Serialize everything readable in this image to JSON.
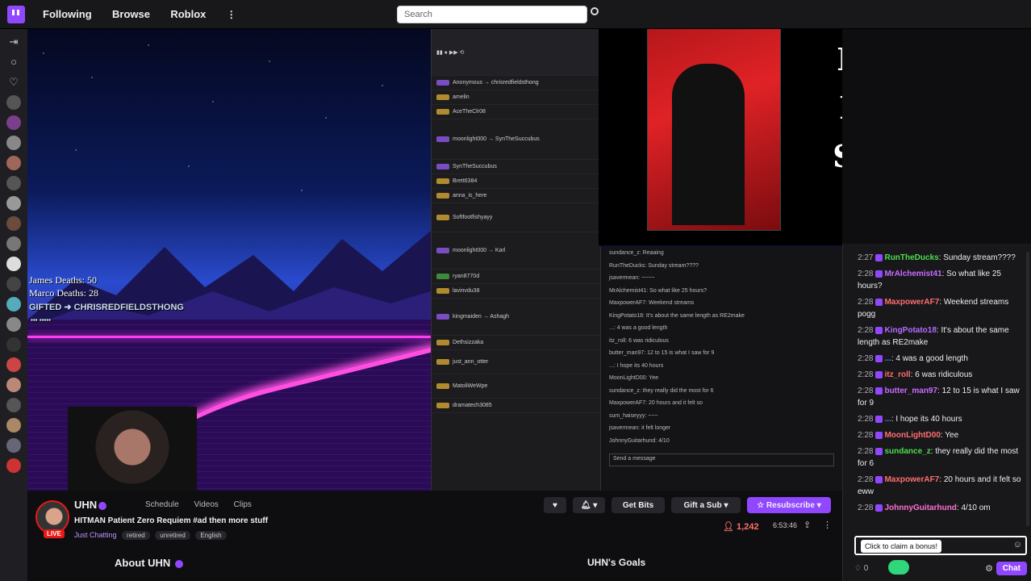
{
  "nav": {
    "following": "Following",
    "browse": "Browse",
    "roblox": "Roblox",
    "more": "⋮"
  },
  "search": {
    "placeholder": "Search"
  },
  "overlay": {
    "james_deaths": "James Deaths: 50",
    "marco_deaths": "Marco Deaths: 28",
    "gifted": "GIFTED ➜ CHRISREDFIELDSTHONG"
  },
  "channel": {
    "name": "UHN",
    "live": "LIVE",
    "tabs": [
      "Schedule",
      "Videos",
      "Clips"
    ],
    "title": "HITMAN Patient Zero Requiem #ad then more stuff",
    "category": "Just Chatting",
    "tags": [
      "retired",
      "unretired",
      "English"
    ],
    "viewers": "1,242",
    "uptime": "6:53:46",
    "about": "About UHN",
    "goals": "UHN's Goals"
  },
  "buttons": {
    "bits": "Get Bits",
    "gift": "Gift a Sub",
    "resub": "Resubscribe"
  },
  "chat": {
    "messages": [
      {
        "ts": "2:27",
        "user": "RunTheDucks",
        "color": "#4fdc4f",
        "text": "Sunday stream????"
      },
      {
        "ts": "2:28",
        "user": "MrAlchemist41",
        "color": "#c86bff",
        "text": "So what like 25 hours?"
      },
      {
        "ts": "2:28",
        "user": "MaxpowerAF7",
        "color": "#ff6f6f",
        "text": "Weekend streams pogg"
      },
      {
        "ts": "2:28",
        "user": "KingPotato18",
        "color": "#b86bff",
        "text": "It's about the same length as RE2make"
      },
      {
        "ts": "2:28",
        "user": "...",
        "color": "#5b7bff",
        "text": "4 was a good length"
      },
      {
        "ts": "2:28",
        "user": "itz_roll",
        "color": "#ff6f6f",
        "text": "6 was ridiculous"
      },
      {
        "ts": "2:28",
        "user": "butter_man97",
        "color": "#c86bff",
        "text": "12 to 15 is what I saw for 9"
      },
      {
        "ts": "2:28",
        "user": "...",
        "color": "#5b7bff",
        "text": "I hope its 40 hours"
      },
      {
        "ts": "2:28",
        "user": "MoonLightD00",
        "color": "#ff6f6f",
        "text": "Yee"
      },
      {
        "ts": "2:28",
        "user": "sundance_z",
        "color": "#4fdc4f",
        "text": "they really did the most for 6"
      },
      {
        "ts": "2:28",
        "user": "MaxpowerAF7",
        "color": "#ff6f6f",
        "text": "20 hours and it felt so eww"
      },
      {
        "ts": "2:28",
        "user": "JohnnyGuitarhund",
        "color": "#ff6fd0",
        "text": "4/10 om"
      }
    ],
    "tooltip": "Click to claim a bonus!",
    "points": "0",
    "chat_button": "Chat"
  },
  "colors": {
    "accent": "#9147ff",
    "live": "#e91916"
  }
}
